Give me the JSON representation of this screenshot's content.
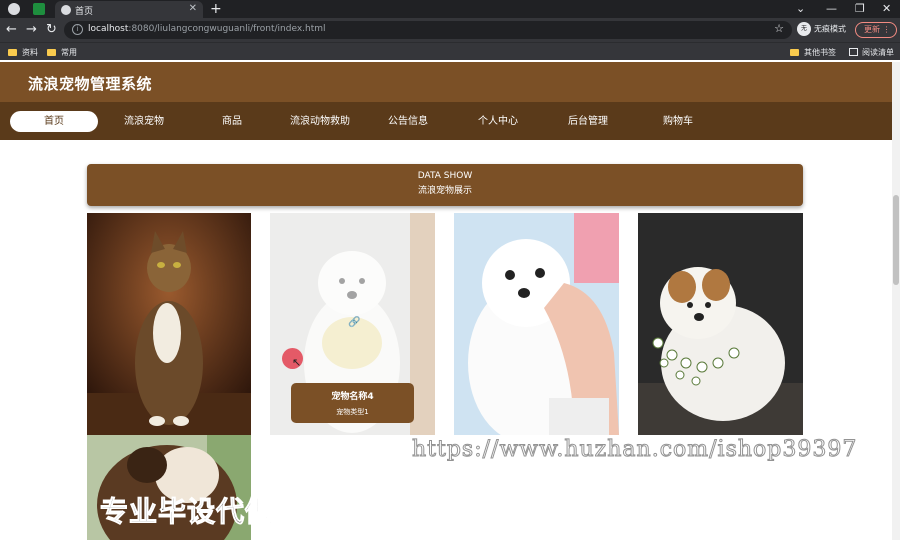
{
  "browser": {
    "tab_title": "首页",
    "url_host": "localhost",
    "url_rest": ":8080/liulangcongwuguanli/front/index.html",
    "profile_label": "无痕模式",
    "profile_avatar": "无",
    "update_label": "更新",
    "bookmarks": [
      "资料",
      "常用"
    ],
    "bookmarks_right": [
      "其他书签",
      "阅读清单"
    ]
  },
  "site": {
    "title": "流浪宠物管理系统",
    "nav": [
      "首页",
      "流浪宠物",
      "商品",
      "流浪动物救助",
      "公告信息",
      "个人中心",
      "后台管理",
      "购物车"
    ]
  },
  "section": {
    "title_en": "DATA SHOW",
    "title_cn": "流浪宠物展示"
  },
  "hover_card": {
    "name": "宠物名称4",
    "type": "宠物类型1"
  },
  "overlay_text": {
    "watermark": "https://www.huzhan.com/ishop39397",
    "caption": "专业毕设代做"
  },
  "colors": {
    "brand": "#7b5026",
    "nav_bg": "#5a3a1a"
  }
}
